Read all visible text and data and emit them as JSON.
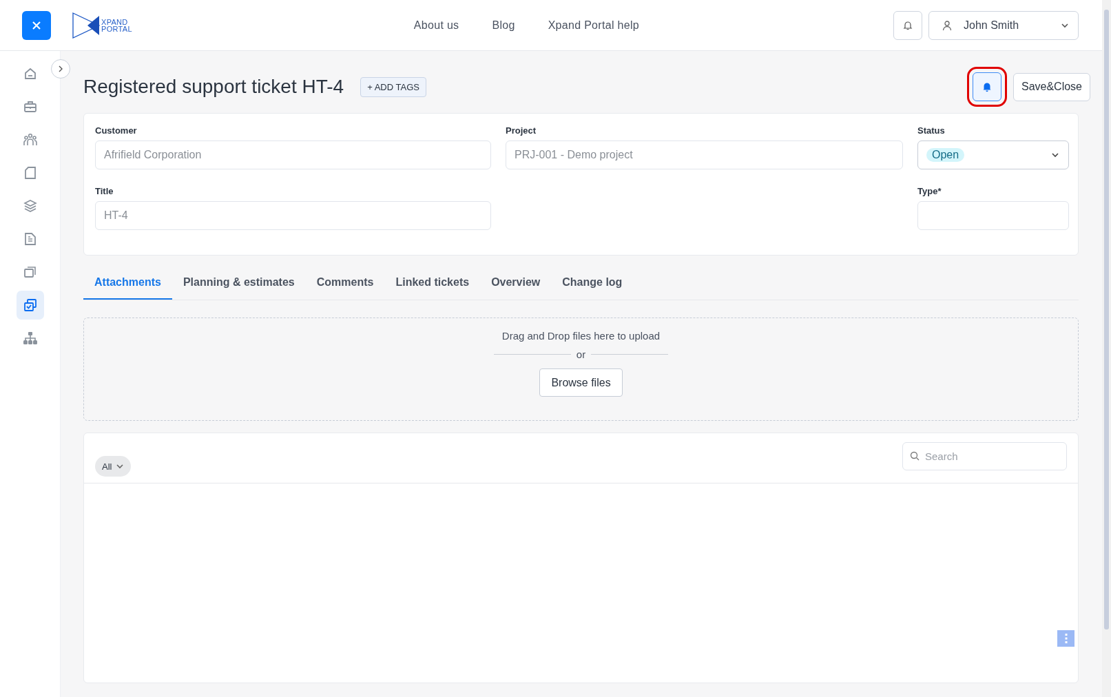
{
  "header": {
    "logo_text": [
      "XPAND",
      "PORTAL"
    ],
    "nav": [
      "About us",
      "Blog",
      "Xpand Portal help"
    ],
    "user": "John Smith"
  },
  "sidebar": {
    "items": [
      {
        "kind": "home",
        "selected": false
      },
      {
        "kind": "briefcase",
        "selected": false
      },
      {
        "kind": "people",
        "selected": false
      },
      {
        "kind": "document",
        "selected": false
      },
      {
        "kind": "layers",
        "selected": false
      },
      {
        "kind": "file-text",
        "selected": false
      },
      {
        "kind": "folders",
        "selected": false
      },
      {
        "kind": "tickets",
        "selected": true
      },
      {
        "kind": "hierarchy",
        "selected": false
      }
    ]
  },
  "page": {
    "title": "Registered support ticket HT-4",
    "add_tags": "+ ADD TAGS",
    "subscribe_highlighted": true,
    "save_close": "Save&Close"
  },
  "form": {
    "customer": {
      "label": "Customer",
      "placeholder": "Afrifield Corporation"
    },
    "project": {
      "label": "Project",
      "placeholder": "PRJ-001 - Demo project"
    },
    "status": {
      "label": "Status",
      "value": "Open"
    },
    "title": {
      "label": "Title",
      "placeholder": "HT-4"
    },
    "type": {
      "label": "Type*"
    }
  },
  "tabs": [
    {
      "label": "Attachments",
      "selected": true
    },
    {
      "label": "Planning & estimates",
      "selected": false
    },
    {
      "label": "Comments",
      "selected": false
    },
    {
      "label": "Linked tickets",
      "selected": false
    },
    {
      "label": "Overview",
      "selected": false
    },
    {
      "label": "Change log",
      "selected": false
    }
  ],
  "upload": {
    "prompt": "Drag and Drop files here to upload",
    "or": "or",
    "browse": "Browse files"
  },
  "list": {
    "filter": "All",
    "search_placeholder": "Search"
  }
}
